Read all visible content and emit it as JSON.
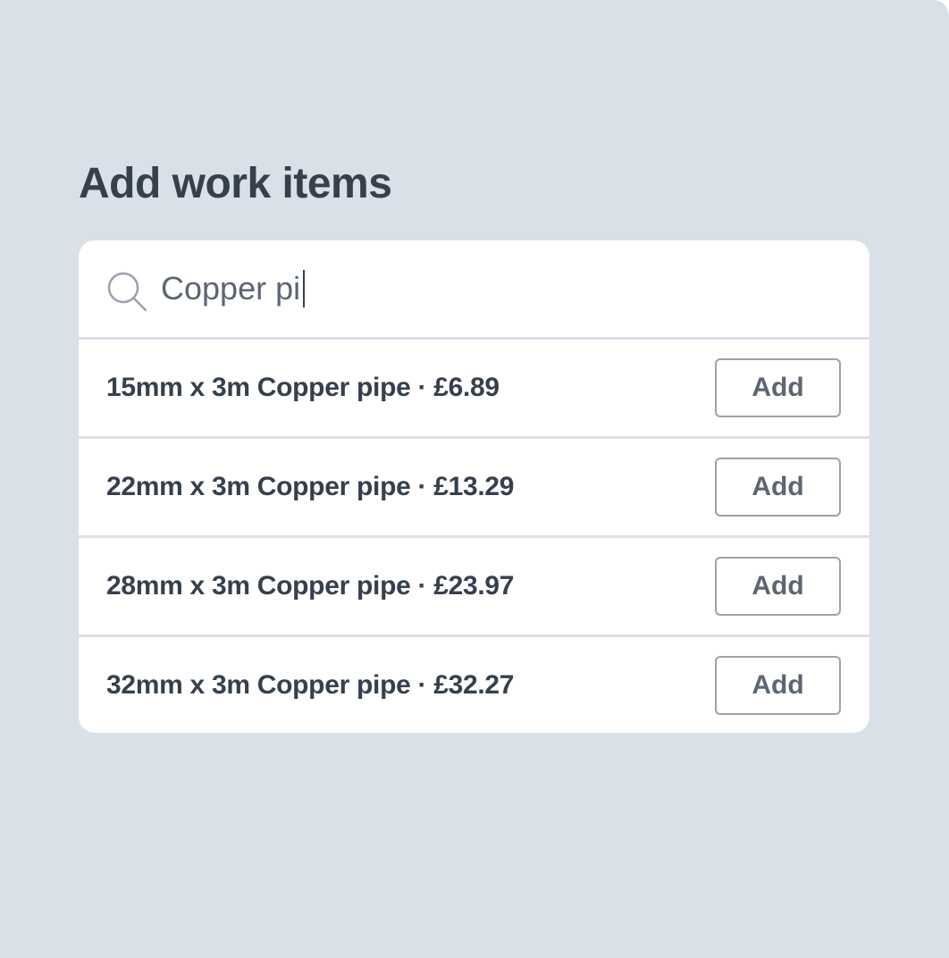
{
  "page": {
    "title": "Add work items"
  },
  "search": {
    "value": "Copper pi",
    "icon": "search-icon"
  },
  "results": [
    {
      "label": "15mm x 3m Copper pipe · £6.89",
      "button": "Add"
    },
    {
      "label": "22mm x 3m Copper pipe · £13.29",
      "button": "Add"
    },
    {
      "label": "28mm x 3m Copper pipe · £23.97",
      "button": "Add"
    },
    {
      "label": "32mm x 3m Copper pipe · £32.27",
      "button": "Add"
    }
  ],
  "colors": {
    "background": "#d9e0e8",
    "card": "#ffffff",
    "text": "#36404d",
    "muted_text": "#5c6673",
    "button_border": "#9aa2ad"
  }
}
